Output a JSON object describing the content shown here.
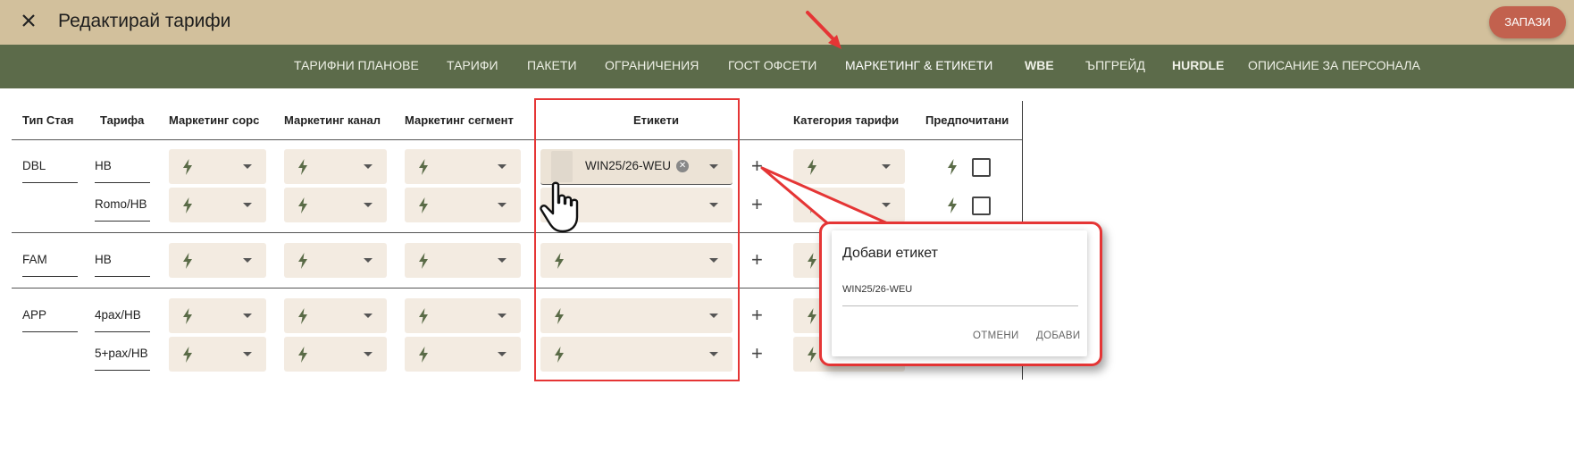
{
  "header": {
    "title": "Редактирай тарифи",
    "save_label": "ЗАПАЗИ"
  },
  "tabs": [
    {
      "label": "ТАРИФНИ ПЛАНОВЕ"
    },
    {
      "label": "ТАРИФИ"
    },
    {
      "label": "ПАКЕТИ"
    },
    {
      "label": "ОГРАНИЧЕНИЯ"
    },
    {
      "label": "ГОСТ ОФСЕТИ"
    },
    {
      "label": "МАРКЕТИНГ & ЕТИКЕТИ",
      "active": true
    },
    {
      "label": "WBE"
    },
    {
      "label": "ЪПГРЕЙД"
    },
    {
      "label": "HURDLE"
    },
    {
      "label": "ОПИСАНИЕ ЗА ПЕРСОНАЛА"
    }
  ],
  "table": {
    "headers": [
      "Тип Стая",
      "Тарифа",
      "Маркетинг сорс",
      "Маркетинг канал",
      "Маркетинг сегмент",
      "Етикети",
      "Категория тарифи",
      "Предпочитани"
    ],
    "rows": [
      {
        "room": "DBL",
        "rate": "HB",
        "tag": "WIN25/26-WEU"
      },
      {
        "room": "",
        "rate": "Romo/HB",
        "tag": ""
      },
      {
        "room": "FAM",
        "rate": "HB",
        "tag": ""
      },
      {
        "room": "APP",
        "rate": "4pax/HB",
        "tag": ""
      },
      {
        "room": "",
        "rate": "5+pax/HB",
        "tag": ""
      }
    ]
  },
  "popup": {
    "title": "Добави етикет",
    "input_value": "WIN25/26-WEU",
    "cancel_label": "ОТМЕНИ",
    "add_label": "ДОБАВИ"
  },
  "colors": {
    "topbar": "#d2c09c",
    "navbar": "#5c6b4a",
    "save_button": "#c2614e",
    "select_bg": "#f3ebe1",
    "bolt": "#5a6b47",
    "highlight": "#e53535"
  },
  "icons": [
    "close-icon",
    "bolt-icon",
    "dropdown-arrow-icon",
    "plus-icon",
    "checkbox-icon",
    "chip-remove-icon",
    "hand-cursor-icon",
    "red-arrow-annotation"
  ]
}
